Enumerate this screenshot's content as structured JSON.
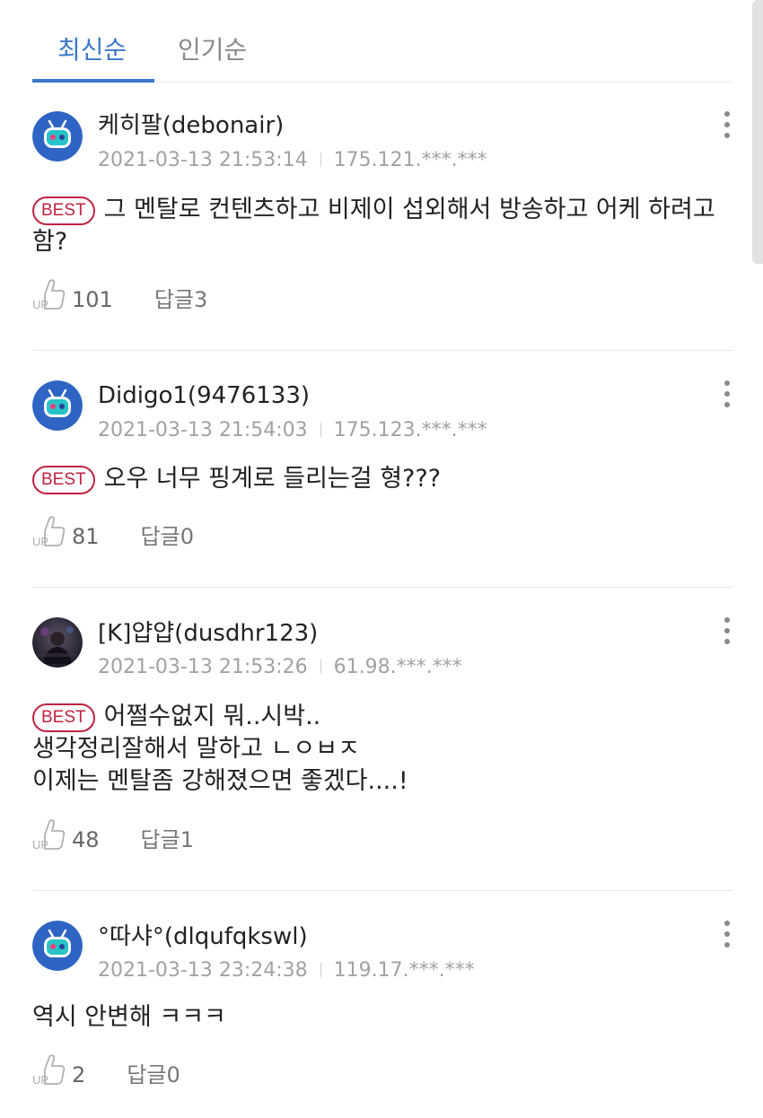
{
  "tabs": [
    {
      "label": "최신순",
      "active": true
    },
    {
      "label": "인기순",
      "active": false
    }
  ],
  "colors": {
    "accent": "#3b78c9",
    "best_badge": "#c0233f",
    "meta_text": "#a2a2a2"
  },
  "comments": [
    {
      "author": "케히팔(debonair)",
      "date": "2021-03-13 21:53:14",
      "ip": "175.121.***.***",
      "best": true,
      "best_label": "BEST",
      "lines": [
        "그 멘탈로 컨텐츠하고 비제이 섭외해서 방송하고 어케 하려고",
        "함?"
      ],
      "up_count": "101",
      "reply_label": "답글3",
      "avatar_icon": "tv-mascot-icon"
    },
    {
      "author": "Didigo1(9476133)",
      "date": "2021-03-13 21:54:03",
      "ip": "175.123.***.***",
      "best": true,
      "best_label": "BEST",
      "lines": [
        "오우 너무 핑계로 들리는걸 형???"
      ],
      "up_count": "81",
      "reply_label": "답글0",
      "avatar_icon": "tv-mascot-icon"
    },
    {
      "author": "[K]얍얍(dusdhr123)",
      "date": "2021-03-13 21:53:26",
      "ip": "61.98.***.***",
      "best": true,
      "best_label": "BEST",
      "lines": [
        "어쩔수없지 뭐..시박..",
        "생각정리잘해서 말하고 ㄴㅇㅂㅈ",
        "이제는 멘탈좀 강해졌으면 좋겠다....!"
      ],
      "up_count": "48",
      "reply_label": "답글1",
      "avatar_icon": "user-photo-avatar"
    },
    {
      "author": "°따샤°(dlqufqkswl)",
      "date": "2021-03-13 23:24:38",
      "ip": "119.17.***.***",
      "best": false,
      "best_label": "",
      "lines": [
        "역시 안변해 ㅋㅋㅋ"
      ],
      "up_count": "2",
      "reply_label": "답글0",
      "avatar_icon": "tv-mascot-icon"
    }
  ]
}
